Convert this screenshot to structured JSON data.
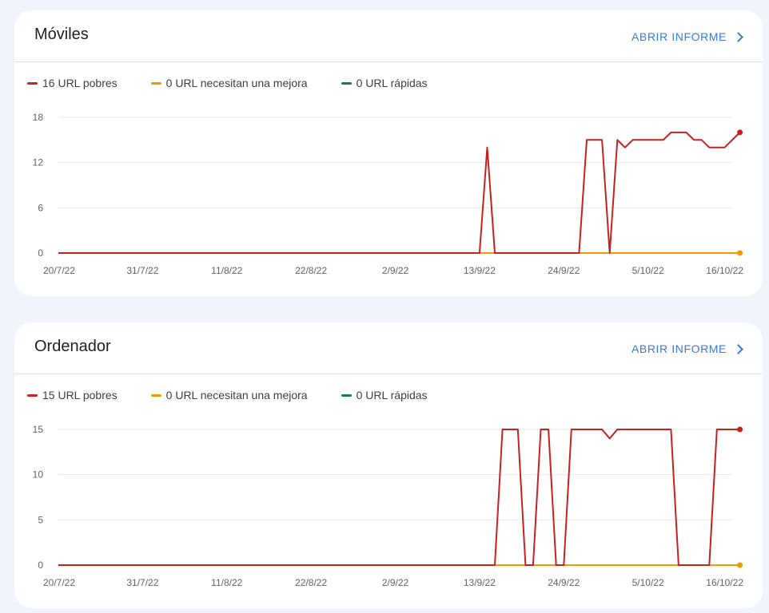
{
  "cards": [
    {
      "title": "Móviles",
      "open_label": "ABRIR INFORME",
      "legend": [
        {
          "label": "16 URL pobres",
          "color": "#c5221f"
        },
        {
          "label": "0 URL necesitan una mejora",
          "color": "#f29900"
        },
        {
          "label": "0 URL rápidas",
          "color": "#188038"
        }
      ]
    },
    {
      "title": "Ordenador",
      "open_label": "ABRIR INFORME",
      "legend": [
        {
          "label": "15 URL pobres",
          "color": "#c5221f"
        },
        {
          "label": "0 URL necesitan una mejora",
          "color": "#f29900"
        },
        {
          "label": "0 URL rápidas",
          "color": "#188038"
        }
      ]
    }
  ],
  "chart_data": [
    {
      "type": "line",
      "title": "Móviles",
      "x_ticks": [
        "20/7/22",
        "31/7/22",
        "11/8/22",
        "22/8/22",
        "2/9/22",
        "13/9/22",
        "24/9/22",
        "5/10/22",
        "16/10/22"
      ],
      "x_range": [
        "20/7/22",
        "16/10/22"
      ],
      "ylim": [
        0,
        18
      ],
      "y_ticks": [
        0,
        6,
        12,
        18
      ],
      "grid": true,
      "legend_position": "top-left",
      "series": [
        {
          "name": "16 URL pobres",
          "color": "#c5221f",
          "end_marker": true,
          "points": [
            [
              "20/7/22",
              0
            ],
            [
              "13/9/22",
              0
            ],
            [
              "14/9/22",
              14
            ],
            [
              "15/9/22",
              0
            ],
            [
              "26/9/22",
              0
            ],
            [
              "27/9/22",
              15
            ],
            [
              "29/9/22",
              15
            ],
            [
              "30/9/22",
              0
            ],
            [
              "1/10/22",
              15
            ],
            [
              "2/10/22",
              14
            ],
            [
              "3/10/22",
              15
            ],
            [
              "7/10/22",
              15
            ],
            [
              "8/10/22",
              16
            ],
            [
              "10/10/22",
              16
            ],
            [
              "11/10/22",
              15
            ],
            [
              "12/10/22",
              15
            ],
            [
              "13/10/22",
              14
            ],
            [
              "15/10/22",
              14
            ],
            [
              "17/10/22",
              16
            ]
          ]
        },
        {
          "name": "0 URL necesitan una mejora",
          "color": "#f29900",
          "end_marker": true,
          "points": [
            [
              "20/7/22",
              0
            ],
            [
              "30/9/22",
              0
            ],
            [
              "17/10/22",
              0
            ]
          ]
        }
      ]
    },
    {
      "type": "line",
      "title": "Ordenador",
      "x_ticks": [
        "20/7/22",
        "31/7/22",
        "11/8/22",
        "22/8/22",
        "2/9/22",
        "13/9/22",
        "24/9/22",
        "5/10/22",
        "16/10/22"
      ],
      "x_range": [
        "20/7/22",
        "16/10/22"
      ],
      "ylim": [
        0,
        15
      ],
      "y_ticks": [
        0,
        5,
        10,
        15
      ],
      "grid": true,
      "legend_position": "top-left",
      "series": [
        {
          "name": "15 URL pobres",
          "color": "#c5221f",
          "end_marker": true,
          "points": [
            [
              "20/7/22",
              0
            ],
            [
              "15/9/22",
              0
            ],
            [
              "16/9/22",
              15
            ],
            [
              "18/9/22",
              15
            ],
            [
              "19/9/22",
              0
            ],
            [
              "20/9/22",
              0
            ],
            [
              "21/9/22",
              15
            ],
            [
              "22/9/22",
              15
            ],
            [
              "23/9/22",
              0
            ],
            [
              "24/9/22",
              0
            ],
            [
              "25/9/22",
              15
            ],
            [
              "29/9/22",
              15
            ],
            [
              "30/9/22",
              14
            ],
            [
              "1/10/22",
              15
            ],
            [
              "8/10/22",
              15
            ],
            [
              "9/10/22",
              0
            ],
            [
              "13/10/22",
              0
            ],
            [
              "14/10/22",
              15
            ],
            [
              "17/10/22",
              15
            ]
          ]
        },
        {
          "name": "0 URL necesitan una mejora",
          "color": "#f29900",
          "end_marker": true,
          "points": [
            [
              "20/7/22",
              0
            ],
            [
              "24/9/22",
              0
            ],
            [
              "17/10/22",
              0
            ]
          ]
        }
      ]
    }
  ]
}
